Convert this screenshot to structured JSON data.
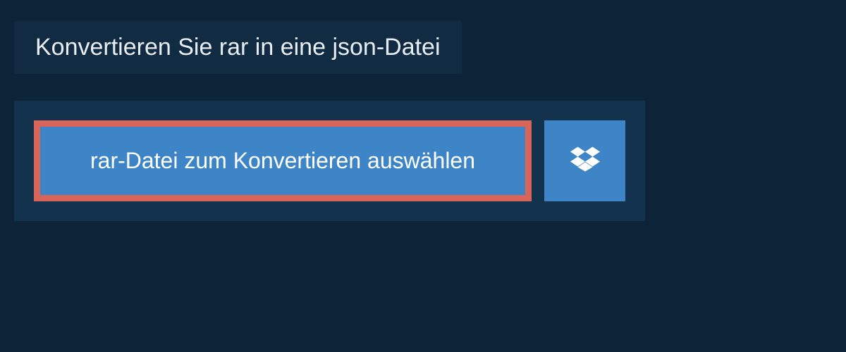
{
  "header": {
    "title": "Konvertieren Sie rar in eine json-Datei"
  },
  "actions": {
    "select_file_label": "rar-Datei zum Konvertieren auswählen",
    "dropbox_icon": "dropbox"
  },
  "colors": {
    "background": "#0d2438",
    "panel": "#12324d",
    "header_bg": "#102b42",
    "button_bg": "#3d85c6",
    "button_border": "#d96459",
    "text_light": "#e8edf2"
  }
}
